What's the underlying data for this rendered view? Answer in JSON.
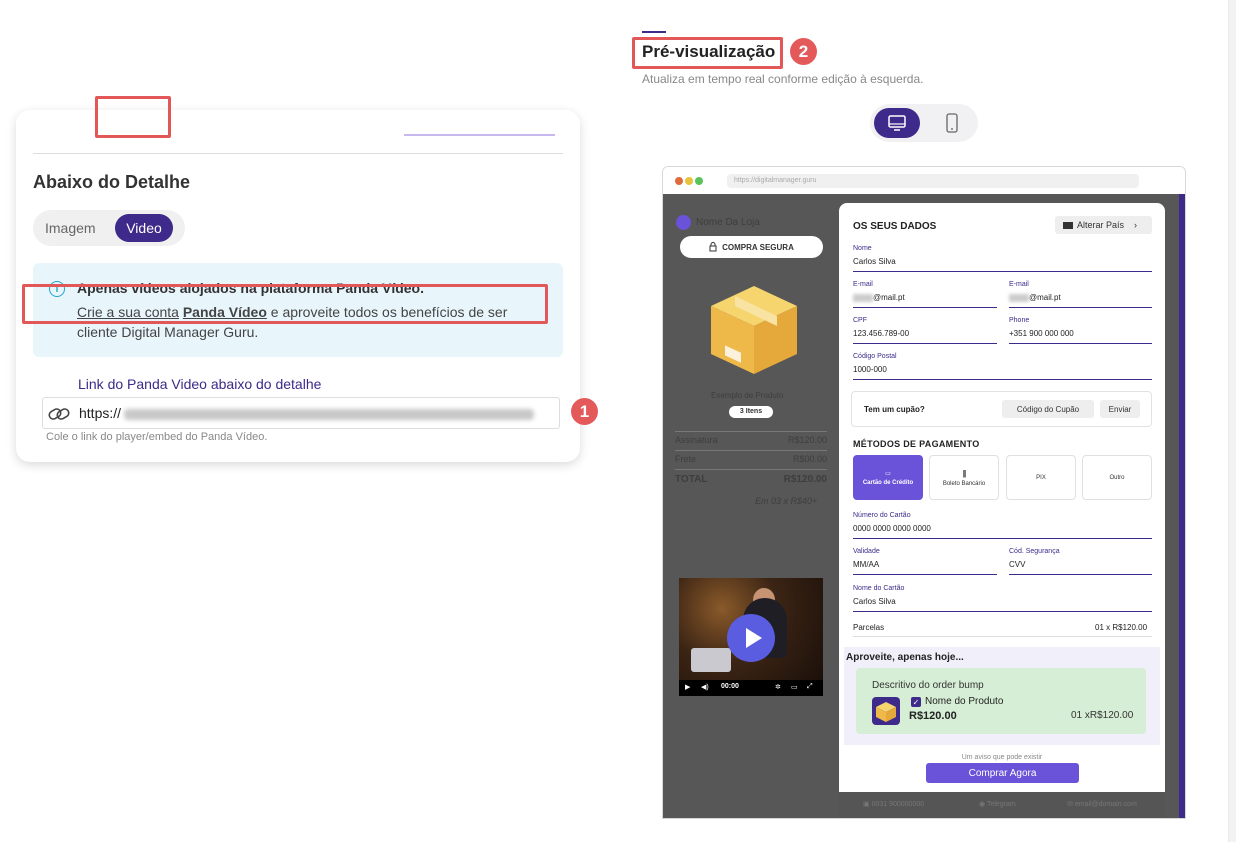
{
  "left_card": {
    "section_title": "Abaixo do Detalhe",
    "tabs": [
      "Imagem",
      "Video"
    ],
    "selected_tab": "Video",
    "info": {
      "icon": "info-icon",
      "title": "Apenas vídeos alojados na plataforma Panda Vídeo.",
      "line2_link": "Crie a sua conta",
      "line2_bold": "Panda Vídeo",
      "line2_rest": " e aproveite todos os benefícios de ser",
      "line3": "cliente Digital Manager Guru."
    },
    "link_label": "Link do Panda Video abaixo do detalhe",
    "url_value": "https://",
    "hint": "Cole o link do player/embed do Panda Vídeo."
  },
  "annotations": {
    "badge1": "1",
    "badge2": "2"
  },
  "preview": {
    "title": "Pré-visualização",
    "subtitle": "Atualiza em tempo real conforme edição à esquerda.",
    "view_modes": [
      "desktop",
      "mobile"
    ],
    "selected_view": "desktop",
    "browser_url": "https://digitalmanager.guru",
    "store_name": "Nome Da Loja",
    "secure_label": "COMPRA SEGURA",
    "product_name": "Exemplo de Produto",
    "items": "3 Itens",
    "summary": [
      {
        "label": "Assinatura",
        "value": "R$120.00"
      },
      {
        "label": "Frete",
        "value": "R$00.00"
      },
      {
        "label": "TOTAL",
        "value": "R$120.00"
      }
    ],
    "installments_note": "Em 03 x R$40+",
    "video": {
      "time": "00:00"
    },
    "checkout": {
      "title": "OS SEUS DADOS",
      "country_button": "Alterar País",
      "fields": {
        "nome": {
          "label": "Nome",
          "value": "Carlos Silva"
        },
        "email1": {
          "label": "E-mail",
          "value": "@mail.pt"
        },
        "email2": {
          "label": "E-mail",
          "value": "@mail.pt"
        },
        "cpf": {
          "label": "CPF",
          "value": "123.456.789-00"
        },
        "phone": {
          "label": "Phone",
          "value": "+351 900 000 000"
        },
        "postal": {
          "label": "Código Postal",
          "value": "1000-000"
        }
      },
      "coupon_question": "Tem um cupão?",
      "coupon_placeholder": "Código do Cupão",
      "coupon_send": "Enviar",
      "payment_title": "MÉTODOS DE PAGAMENTO",
      "payment_methods": [
        "Cartão de Crédito",
        "Boleto Bancário",
        "PIX",
        "Outro"
      ],
      "selected_payment": "Cartão de Crédito",
      "card_fields": {
        "number": {
          "label": "Número do Cartão",
          "value": "0000 0000 0000 0000"
        },
        "validity": {
          "label": "Validade",
          "value": "MM/AA"
        },
        "cvv": {
          "label": "Cód. Segurança",
          "value": "CVV"
        },
        "name": {
          "label": "Nome do Cartão",
          "value": "Carlos Silva"
        },
        "parcelas_label": "Parcelas",
        "parcelas_value": "01 x R$120.00"
      },
      "bump": {
        "heading": "Aproveite, apenas hoje...",
        "description": "Descritivo do order bump",
        "product": "Nome do Produto",
        "price": "R$120.00",
        "installments": "01 xR$120.00",
        "checked": true
      },
      "notice": "Um aviso que pode existir",
      "buy_button": "Comprar Agora",
      "footer": [
        "0031 900000000",
        "Telegram",
        "email@domain.com"
      ]
    }
  },
  "colors": {
    "accent": "#3d2a8a",
    "accent_light": "#6a52d9",
    "highlight": "#e25757",
    "info_bg": "#e8f6fc"
  }
}
